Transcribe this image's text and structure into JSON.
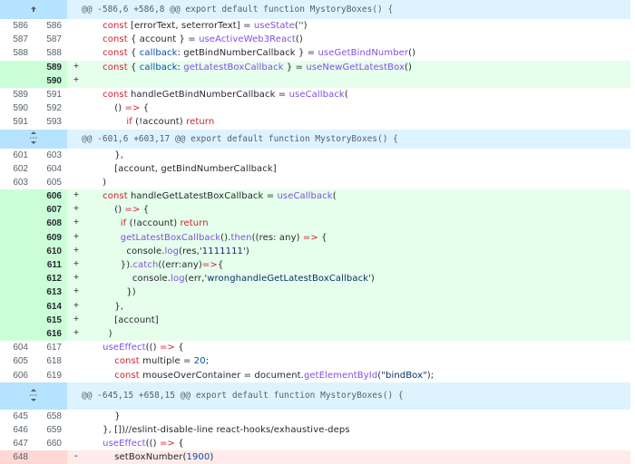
{
  "hunks": [
    {
      "header": "@@ -586,6 +586,8 @@ export default function MystoryBoxes() {",
      "expander_icon": "expand-up-icon",
      "lines": [
        {
          "type": "ctx",
          "old": "586",
          "new": "586",
          "sign": "",
          "code": "    const [errorText, seterrorText] = useState('')"
        },
        {
          "type": "ctx",
          "old": "587",
          "new": "587",
          "sign": "",
          "code": "    const { account } = useActiveWeb3React()"
        },
        {
          "type": "ctx",
          "old": "588",
          "new": "588",
          "sign": "",
          "code": "    const { callback: getBindNumberCallback } = useGetBindNumber()"
        },
        {
          "type": "add",
          "old": "",
          "new": "589",
          "sign": "+",
          "code": "    const { callback: getLatestBoxCallback } = useNewGetLatestBox()"
        },
        {
          "type": "add",
          "old": "",
          "new": "590",
          "sign": "+",
          "code": ""
        },
        {
          "type": "ctx",
          "old": "589",
          "new": "591",
          "sign": "",
          "code": "    const handleGetBindNumberCallback = useCallback("
        },
        {
          "type": "ctx",
          "old": "590",
          "new": "592",
          "sign": "",
          "code": "        () => {"
        },
        {
          "type": "ctx",
          "old": "591",
          "new": "593",
          "sign": "",
          "code": "            if (!account) return"
        }
      ]
    },
    {
      "header": "@@ -601,6 +603,17 @@ export default function MystoryBoxes() {",
      "expander_icon": "expand-both-icon",
      "lines": [
        {
          "type": "ctx",
          "old": "601",
          "new": "603",
          "sign": "",
          "code": "        },"
        },
        {
          "type": "ctx",
          "old": "602",
          "new": "604",
          "sign": "",
          "code": "        [account, getBindNumberCallback]"
        },
        {
          "type": "ctx",
          "old": "603",
          "new": "605",
          "sign": "",
          "code": "    )"
        },
        {
          "type": "add",
          "old": "",
          "new": "606",
          "sign": "+",
          "code": "    const handleGetLatestBoxCallback = useCallback("
        },
        {
          "type": "add",
          "old": "",
          "new": "607",
          "sign": "+",
          "code": "        () => {"
        },
        {
          "type": "add",
          "old": "",
          "new": "608",
          "sign": "+",
          "code": "          if (!account) return"
        },
        {
          "type": "add",
          "old": "",
          "new": "609",
          "sign": "+",
          "code": "          getLatestBoxCallback().then((res: any) => {"
        },
        {
          "type": "add",
          "old": "",
          "new": "610",
          "sign": "+",
          "code": "            console.log(res,'1111111')"
        },
        {
          "type": "add",
          "old": "",
          "new": "611",
          "sign": "+",
          "code": "          }).catch((err:any)=>{"
        },
        {
          "type": "add",
          "old": "",
          "new": "612",
          "sign": "+",
          "code": "              console.log(err,'wronghandleGetLatestBoxCallback')"
        },
        {
          "type": "add",
          "old": "",
          "new": "613",
          "sign": "+",
          "code": "            })"
        },
        {
          "type": "add",
          "old": "",
          "new": "614",
          "sign": "+",
          "code": "        },"
        },
        {
          "type": "add",
          "old": "",
          "new": "615",
          "sign": "+",
          "code": "        [account]"
        },
        {
          "type": "add",
          "old": "",
          "new": "616",
          "sign": "+",
          "code": "      )"
        },
        {
          "type": "ctx",
          "old": "604",
          "new": "617",
          "sign": "",
          "code": "    useEffect(() => {"
        },
        {
          "type": "ctx",
          "old": "605",
          "new": "618",
          "sign": "",
          "code": "        const multiple = 20;"
        },
        {
          "type": "ctx",
          "old": "606",
          "new": "619",
          "sign": "",
          "code": "        const mouseOverContainer = document.getElementById(\"bindBox\");"
        }
      ]
    },
    {
      "header": "@@ -645,15 +658,15 @@ export default function MystoryBoxes() {",
      "expander_icon": "expand-both-icon",
      "lines": [
        {
          "type": "ctx",
          "old": "645",
          "new": "658",
          "sign": "",
          "code": "        }"
        },
        {
          "type": "ctx",
          "old": "646",
          "new": "659",
          "sign": "",
          "code": "    }, [])//eslint-disable-line react-hooks/exhaustive-deps"
        },
        {
          "type": "ctx",
          "old": "647",
          "new": "660",
          "sign": "",
          "code": "    useEffect(() => {"
        },
        {
          "type": "del",
          "old": "648",
          "new": "",
          "sign": "-",
          "code": "        setBoxNumber(1900)"
        }
      ]
    }
  ]
}
